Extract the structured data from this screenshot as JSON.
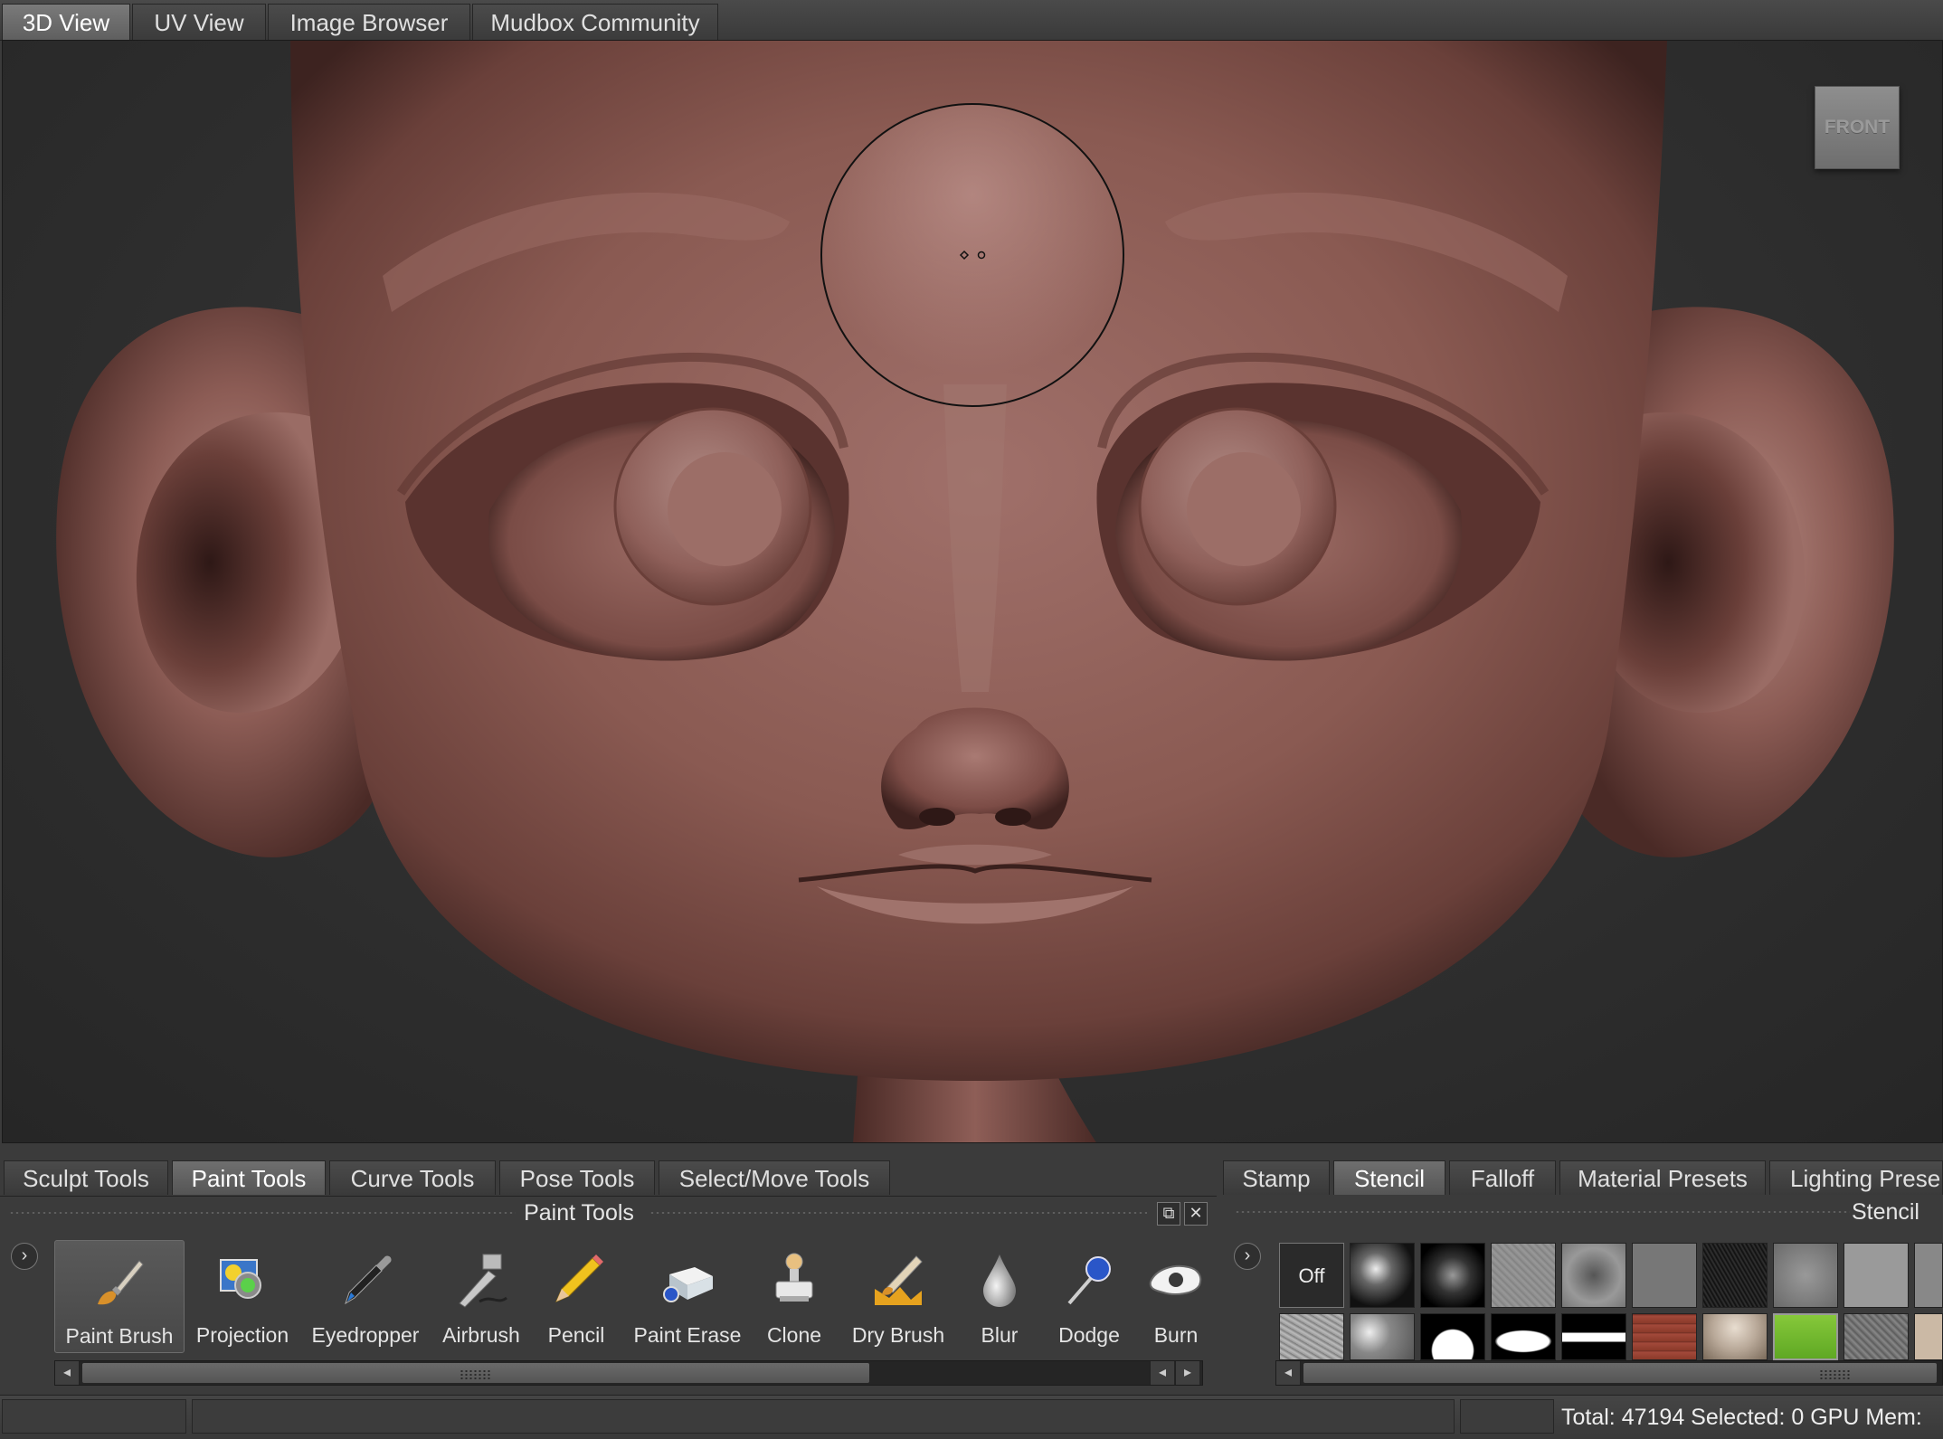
{
  "top_tabs": [
    {
      "label": "3D View",
      "active": true
    },
    {
      "label": "UV View",
      "active": false
    },
    {
      "label": "Image Browser",
      "active": false
    },
    {
      "label": "Mudbox Community",
      "active": false
    }
  ],
  "viewport": {
    "view_cube_label": "FRONT"
  },
  "tool_tabs": [
    {
      "label": "Sculpt Tools",
      "active": false
    },
    {
      "label": "Paint Tools",
      "active": true
    },
    {
      "label": "Curve Tools",
      "active": false
    },
    {
      "label": "Pose Tools",
      "active": false
    },
    {
      "label": "Select/Move Tools",
      "active": false
    }
  ],
  "tray": {
    "title": "Paint Tools",
    "float_icon": "⧉",
    "close_icon": "✕",
    "expand_icon": "›",
    "tools": [
      {
        "label": "Paint Brush",
        "icon": "paint-brush-icon",
        "active": true
      },
      {
        "label": "Projection",
        "icon": "projection-icon",
        "active": false
      },
      {
        "label": "Eyedropper",
        "icon": "eyedropper-icon",
        "active": false
      },
      {
        "label": "Airbrush",
        "icon": "airbrush-icon",
        "active": false
      },
      {
        "label": "Pencil",
        "icon": "pencil-icon",
        "active": false
      },
      {
        "label": "Paint Erase",
        "icon": "paint-erase-icon",
        "active": false
      },
      {
        "label": "Clone",
        "icon": "clone-icon",
        "active": false
      },
      {
        "label": "Dry Brush",
        "icon": "dry-brush-icon",
        "active": false
      },
      {
        "label": "Blur",
        "icon": "blur-icon",
        "active": false
      },
      {
        "label": "Dodge",
        "icon": "dodge-icon",
        "active": false
      },
      {
        "label": "Burn",
        "icon": "burn-icon",
        "active": false
      }
    ],
    "scroll_left": "◂",
    "scroll_right": "▸"
  },
  "browser_tabs": [
    {
      "label": "Stamp",
      "active": false
    },
    {
      "label": "Stencil",
      "active": true
    },
    {
      "label": "Falloff",
      "active": false
    },
    {
      "label": "Material Presets",
      "active": false
    },
    {
      "label": "Lighting Prese",
      "active": false
    }
  ],
  "stencil": {
    "title": "Stencil",
    "off_label": "Off",
    "expand_icon": "›"
  },
  "status": {
    "text": "Total: 47194  Selected: 0 GPU Mem:"
  },
  "colors": {
    "skin": "#8a5a52",
    "skin_light": "#b07e76",
    "skin_dark": "#4e2e2a",
    "panel_bg": "#3b3b3b",
    "active_tab": "#6f6f6f"
  }
}
